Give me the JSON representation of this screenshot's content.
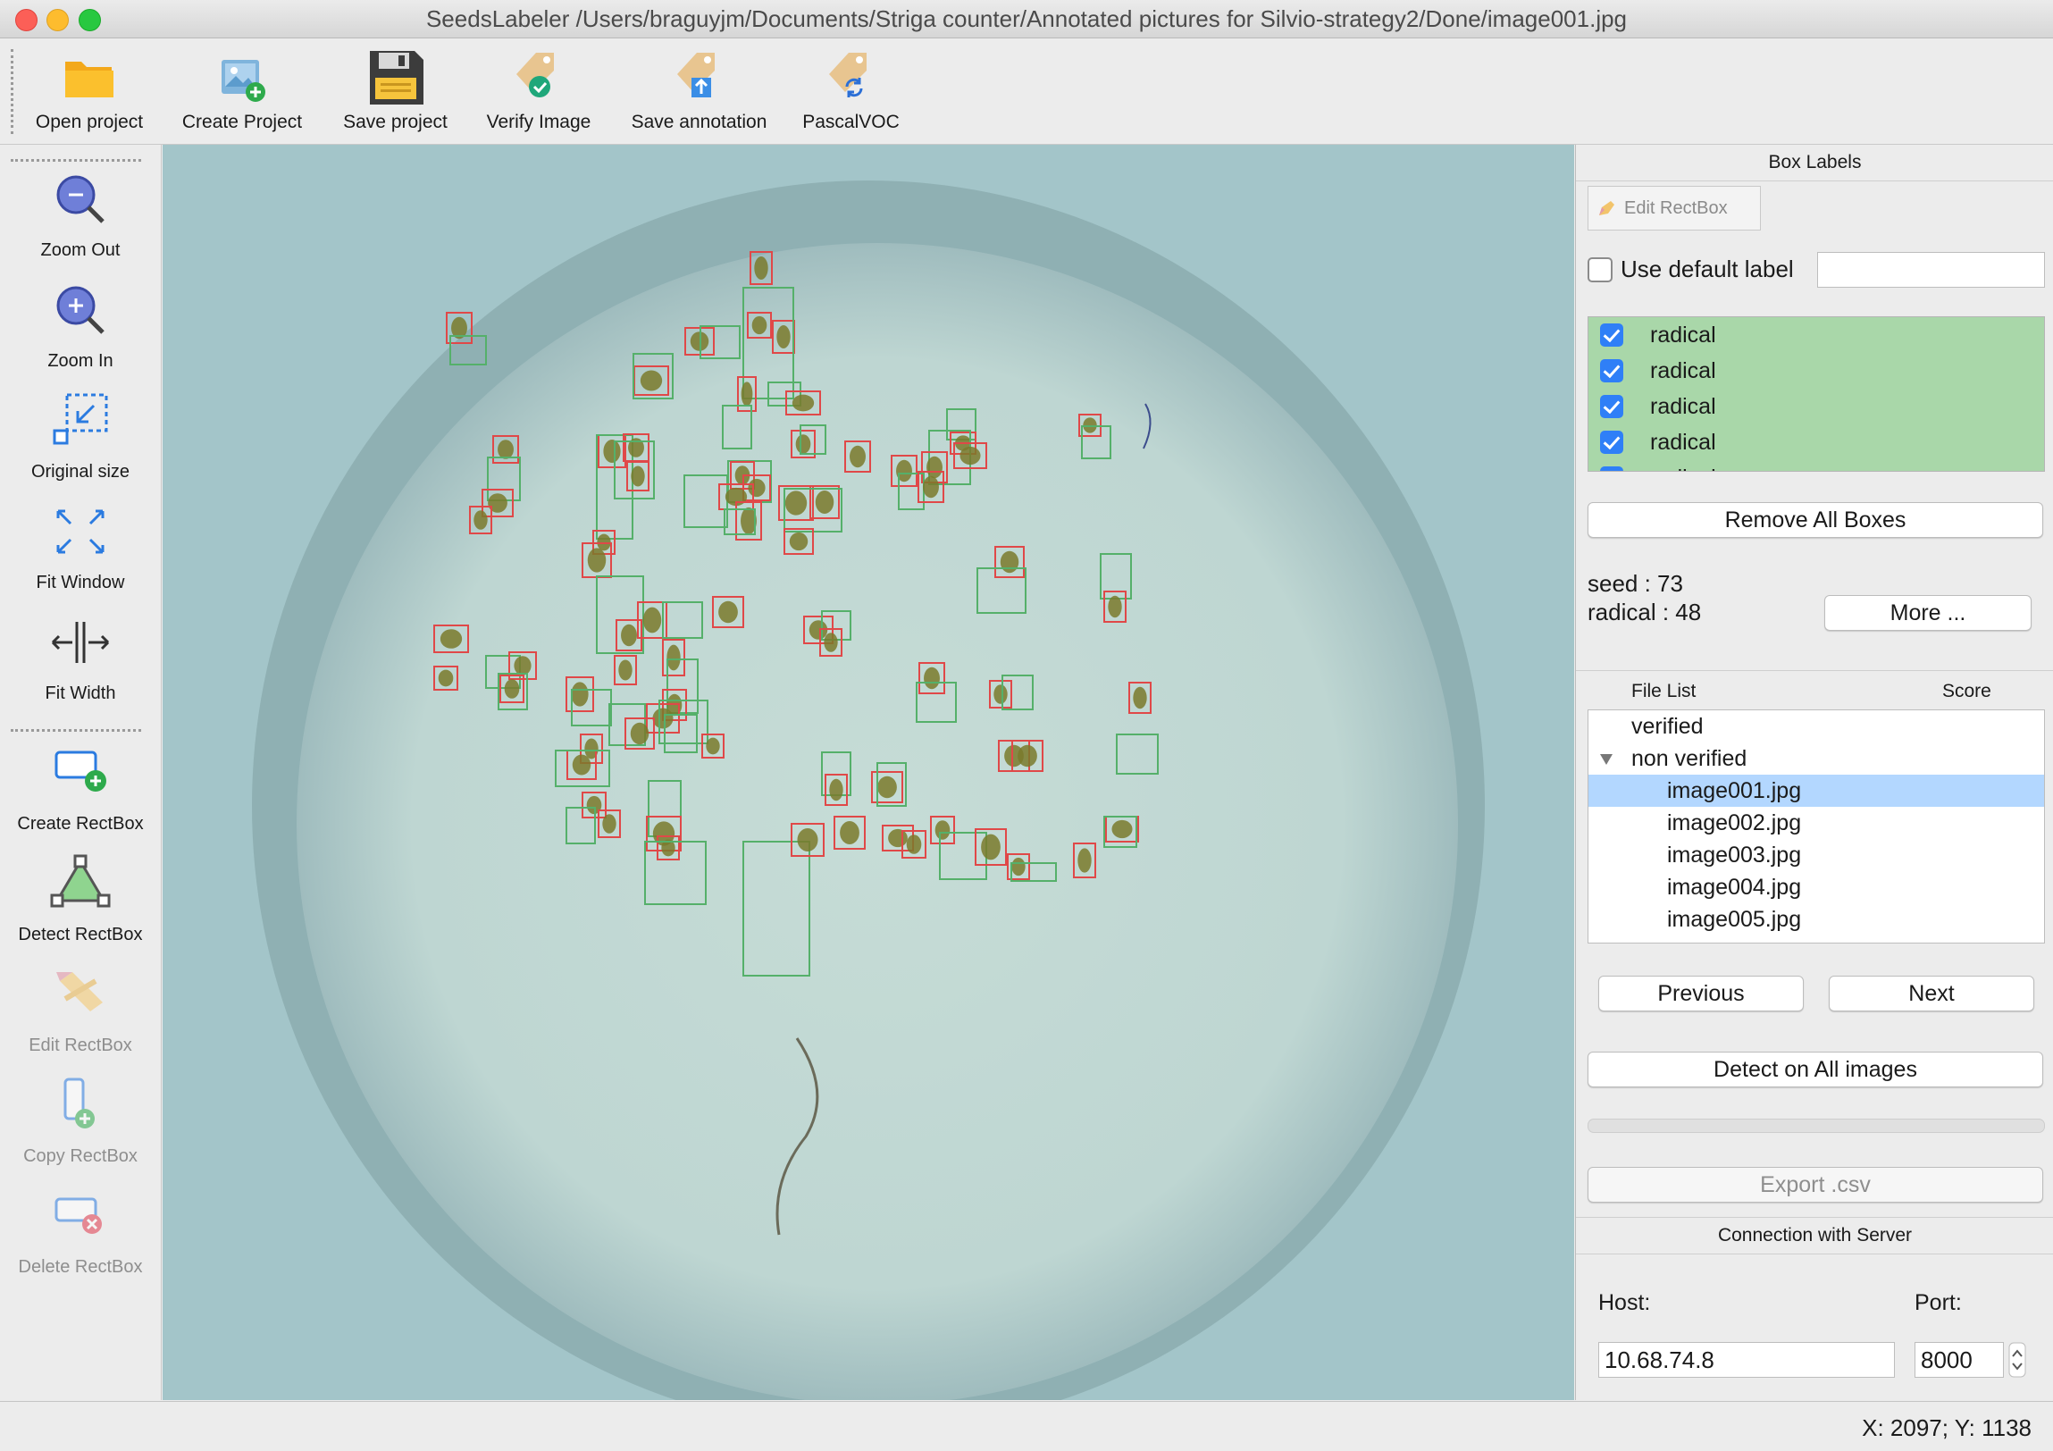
{
  "window": {
    "title": "SeedsLabeler /Users/braguyjm/Documents/Striga counter/Annotated pictures for Silvio-strategy2/Done/image001.jpg"
  },
  "toolbar": {
    "items": [
      {
        "label": "Open project",
        "icon": "folder-icon"
      },
      {
        "label": "Create Project",
        "icon": "create-project-icon"
      },
      {
        "label": "Save project",
        "icon": "floppy-disk-icon"
      },
      {
        "label": "Verify Image",
        "icon": "tag-check-icon"
      },
      {
        "label": "Save annotation",
        "icon": "tag-upload-icon"
      },
      {
        "label": "PascalVOC",
        "icon": "tag-sync-icon"
      }
    ]
  },
  "sidebar": {
    "items": [
      {
        "label": "Zoom Out",
        "icon": "zoom-out-icon",
        "enabled": true
      },
      {
        "label": "Zoom In",
        "icon": "zoom-in-icon",
        "enabled": true
      },
      {
        "label": "Original size",
        "icon": "original-size-icon",
        "enabled": true
      },
      {
        "label": "Fit Window",
        "icon": "fit-window-icon",
        "enabled": true
      },
      {
        "label": "Fit Width",
        "icon": "fit-width-icon",
        "enabled": true
      },
      {
        "label": "Create RectBox",
        "icon": "create-rectbox-icon",
        "enabled": true
      },
      {
        "label": "Detect RectBox",
        "icon": "detect-rectbox-icon",
        "enabled": true
      },
      {
        "label": "Edit RectBox",
        "icon": "edit-rectbox-icon",
        "enabled": false
      },
      {
        "label": "Copy RectBox",
        "icon": "copy-rectbox-icon",
        "enabled": false
      },
      {
        "label": "Delete RectBox",
        "icon": "delete-rectbox-icon",
        "enabled": false
      }
    ]
  },
  "box_labels": {
    "title": "Box Labels",
    "edit_button": "Edit RectBox",
    "use_default_label": "Use default label",
    "default_label_value": "",
    "labels": [
      "radical",
      "radical",
      "radical",
      "radical",
      "radical"
    ],
    "remove_all": "Remove All Boxes",
    "counts": [
      "seed : 73",
      "radical : 48"
    ],
    "more": "More ..."
  },
  "file_list": {
    "header": "File List",
    "score_header": "Score",
    "verified": "verified",
    "non_verified": "non verified",
    "files": [
      "image001.jpg",
      "image002.jpg",
      "image003.jpg",
      "image004.jpg",
      "image005.jpg"
    ],
    "selected": "image001.jpg",
    "previous": "Previous",
    "next": "Next",
    "detect_all": "Detect on All images",
    "export": "Export .csv"
  },
  "server": {
    "title": "Connection with Server",
    "host_label": "Host:",
    "port_label": "Port:",
    "host": "10.68.74.8",
    "port": "8000"
  },
  "status": {
    "coords": "X: 2097; Y: 1138"
  },
  "colors": {
    "seed_box": "#e04848",
    "radical_box": "#55b06a",
    "label_list_bg": "#a9d7a9",
    "selection": "#b3d7ff"
  }
}
